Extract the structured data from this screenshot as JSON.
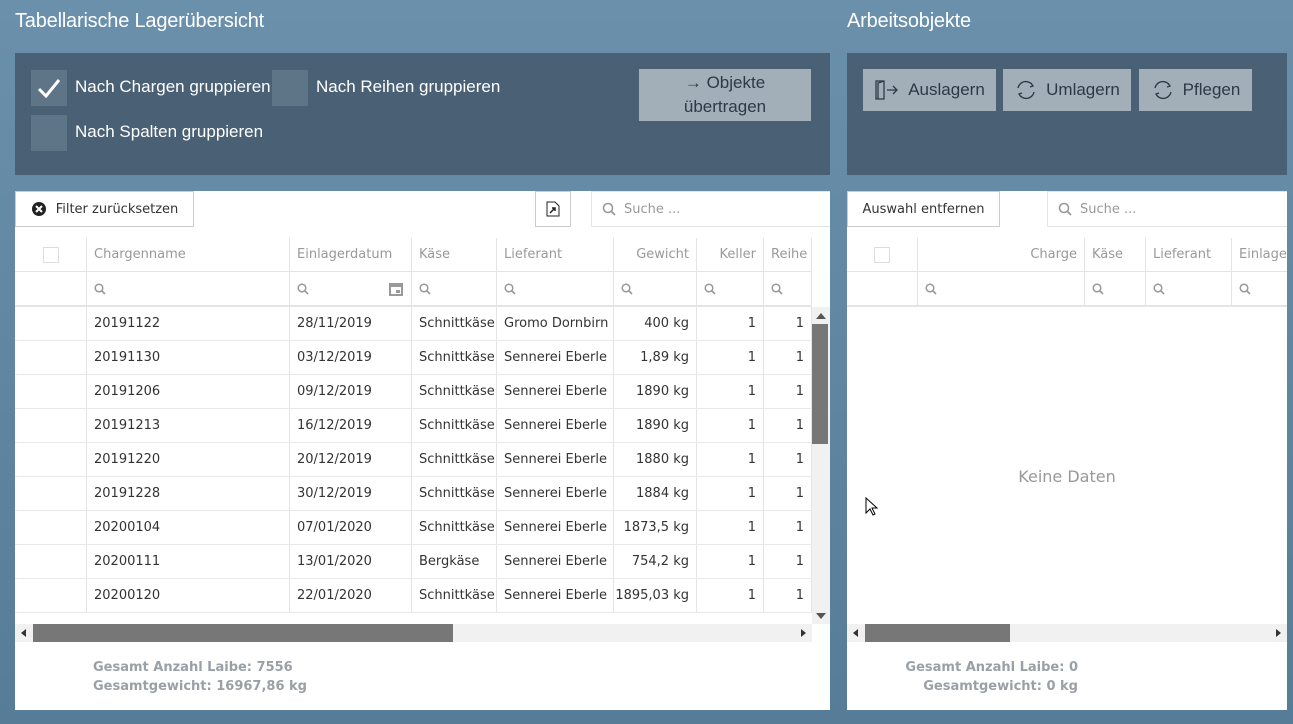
{
  "left": {
    "title": "Tabellarische Lagerübersicht",
    "options": [
      {
        "label": "Nach Chargen gruppieren",
        "checked": true
      },
      {
        "label": "Nach Reihen gruppieren",
        "checked": false
      },
      {
        "label": "Nach Spalten gruppieren",
        "checked": false
      }
    ],
    "transfer_label_1": "→ Objekte",
    "transfer_label_2": "übertragen",
    "reset_filter": "Filter zurücksetzen",
    "search_placeholder": "Suche ...",
    "columns": [
      "Chargenname",
      "Einlagerdatum",
      "Käse",
      "Lieferant",
      "Gewicht",
      "Keller",
      "Reihe"
    ],
    "rows": [
      [
        "20191122",
        "28/11/2019",
        "Schnittkäse",
        "Gromo Dornbirn",
        "400 kg",
        "1",
        "1"
      ],
      [
        "20191130",
        "03/12/2019",
        "Schnittkäse",
        "Sennerei Eberle",
        "1,89 kg",
        "1",
        "1"
      ],
      [
        "20191206",
        "09/12/2019",
        "Schnittkäse",
        "Sennerei Eberle",
        "1890 kg",
        "1",
        "1"
      ],
      [
        "20191213",
        "16/12/2019",
        "Schnittkäse",
        "Sennerei Eberle",
        "1890 kg",
        "1",
        "1"
      ],
      [
        "20191220",
        "20/12/2019",
        "Schnittkäse",
        "Sennerei Eberle",
        "1880 kg",
        "1",
        "1"
      ],
      [
        "20191228",
        "30/12/2019",
        "Schnittkäse",
        "Sennerei Eberle",
        "1884 kg",
        "1",
        "1"
      ],
      [
        "20200104",
        "07/01/2020",
        "Schnittkäse",
        "Sennerei Eberle",
        "1873,5 kg",
        "1",
        "1"
      ],
      [
        "20200111",
        "13/01/2020",
        "Bergkäse",
        "Sennerei Eberle",
        "754,2 kg",
        "1",
        "1"
      ],
      [
        "20200120",
        "22/01/2020",
        "Schnittkäse",
        "Sennerei Eberle",
        "1895,03 kg",
        "1",
        "1"
      ]
    ],
    "total_count": "Gesamt Anzahl Laibe: 7556",
    "total_weight": "Gesamtgewicht: 16967,86 kg"
  },
  "right": {
    "title": "Arbeitsobjekte",
    "buttons": [
      "Auslagern",
      "Umlagern",
      "Pflegen"
    ],
    "remove_selection": "Auswahl entfernen",
    "search_placeholder": "Suche ...",
    "columns": [
      "Charge",
      "Käse",
      "Lieferant",
      "Einlagerdatum"
    ],
    "empty": "Keine Daten",
    "total_count": "Gesamt Anzahl Laibe: 0",
    "total_weight": "Gesamtgewicht: 0 kg"
  }
}
